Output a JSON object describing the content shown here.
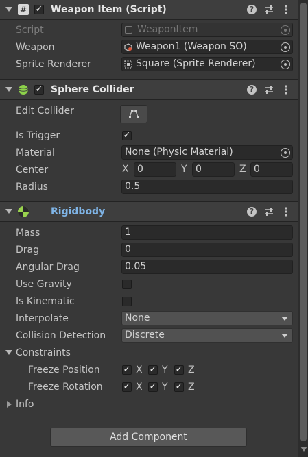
{
  "weapon_item": {
    "title": "Weapon Item (Script)",
    "script_label": "Script",
    "script_value": "WeaponItem",
    "weapon_label": "Weapon",
    "weapon_value": "Weapon1 (Weapon SO)",
    "sprite_label": "Sprite Renderer",
    "sprite_value": "Square (Sprite Renderer)"
  },
  "sphere_collider": {
    "title": "Sphere Collider",
    "edit_collider_label": "Edit Collider",
    "is_trigger_label": "Is Trigger",
    "is_trigger_mark": "✓",
    "material_label": "Material",
    "material_value": "None (Physic Material)",
    "center_label": "Center",
    "center_x_label": "X",
    "center_x": "0",
    "center_y_label": "Y",
    "center_y": "0",
    "center_z_label": "Z",
    "center_z": "0",
    "radius_label": "Radius",
    "radius_value": "0.5"
  },
  "rigidbody": {
    "title": "Rigidbody",
    "title_color": "#7fb4e6",
    "mass_label": "Mass",
    "mass_value": "1",
    "drag_label": "Drag",
    "drag_value": "0",
    "angular_drag_label": "Angular Drag",
    "angular_drag_value": "0.05",
    "use_gravity_label": "Use Gravity",
    "is_kinematic_label": "Is Kinematic",
    "interpolate_label": "Interpolate",
    "interpolate_value": "None",
    "collision_label": "Collision Detection",
    "collision_value": "Discrete",
    "constraints_label": "Constraints",
    "freeze_position_label": "Freeze Position",
    "freeze_rotation_label": "Freeze Rotation",
    "axis_x": "X",
    "axis_y": "Y",
    "axis_z": "Z",
    "check_mark": "✓",
    "info_label": "Info"
  },
  "header_icons": {
    "help": "?",
    "check": "✓"
  },
  "add_component_label": "Add Component"
}
